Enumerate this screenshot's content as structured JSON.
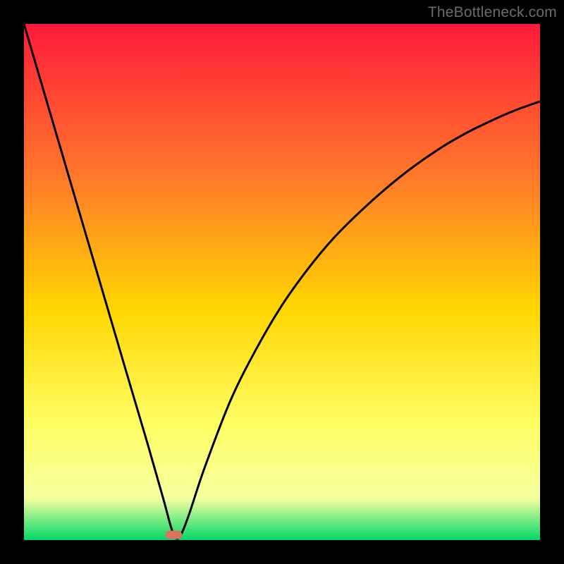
{
  "watermark": "TheBottleneck.com",
  "colors": {
    "frame": "#000000",
    "gradient_top": "#ff1a3a",
    "gradient_mid1": "#ff7a2a",
    "gradient_mid2": "#ffd500",
    "gradient_mid3": "#ffff66",
    "gradient_mid4": "#f5ffa0",
    "gradient_bottom": "#00d867",
    "curve": "#000000",
    "marker": "#d8735f"
  },
  "chart_data": {
    "type": "line",
    "title": "",
    "xlabel": "",
    "ylabel": "",
    "xlim": [
      0,
      100
    ],
    "ylim": [
      0,
      100
    ],
    "annotations": [],
    "marker": {
      "x": 29,
      "y": 1
    },
    "series": [
      {
        "name": "bottleneck-curve",
        "x": [
          0,
          5,
          10,
          15,
          20,
          24,
          27,
          28.5,
          29.5,
          30.5,
          32,
          35,
          40,
          45,
          50,
          55,
          60,
          65,
          70,
          75,
          80,
          85,
          90,
          95,
          100
        ],
        "values": [
          100,
          83,
          66,
          49,
          32,
          18.5,
          8,
          2.5,
          0.3,
          1.2,
          5,
          14,
          27,
          37,
          45.5,
          52.5,
          58.5,
          63.5,
          68,
          72,
          75.5,
          78.5,
          81,
          83.2,
          85
        ]
      }
    ]
  }
}
